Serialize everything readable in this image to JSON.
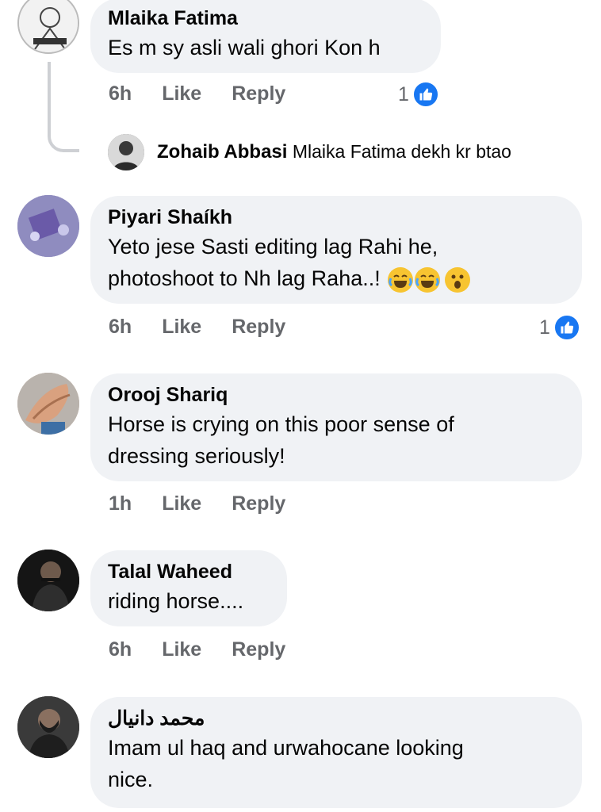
{
  "comments": [
    {
      "author": "Mlaika Fatima",
      "lines": [
        "Es m sy asli wali ghori Kon h"
      ],
      "time": "6h",
      "like": "Like",
      "reply": "Reply",
      "reaction_count": "1",
      "reply_item": {
        "author": "Zohaib Abbasi",
        "text": "Mlaika Fatima dekh kr btao"
      }
    },
    {
      "author": "Piyari Shaíkh",
      "lines": [
        "Yeto jese Sasti editing lag Rahi he,",
        "photoshoot to Nh lag Raha..!"
      ],
      "emojis": [
        "laughing-crying",
        "laughing-crying",
        "surprised"
      ],
      "time": "6h",
      "like": "Like",
      "reply": "Reply",
      "reaction_count": "1"
    },
    {
      "author": "Orooj Shariq",
      "lines": [
        "Horse is crying on this poor sense of",
        "dressing seriously!"
      ],
      "time": "1h",
      "like": "Like",
      "reply": "Reply"
    },
    {
      "author": "Talal Waheed",
      "lines": [
        "riding horse...."
      ],
      "time": "6h",
      "like": "Like",
      "reply": "Reply"
    },
    {
      "author": "محمد دانیال",
      "lines": [
        "Imam ul haq and urwahocane looking",
        "nice."
      ]
    }
  ],
  "colors": {
    "bubble": "#f0f2f5",
    "like_blue": "#1877f2",
    "meta_gray": "#65676b"
  },
  "icons": [
    "like-thumb-icon",
    "laughing-crying-emoji-icon",
    "surprised-emoji-icon"
  ]
}
